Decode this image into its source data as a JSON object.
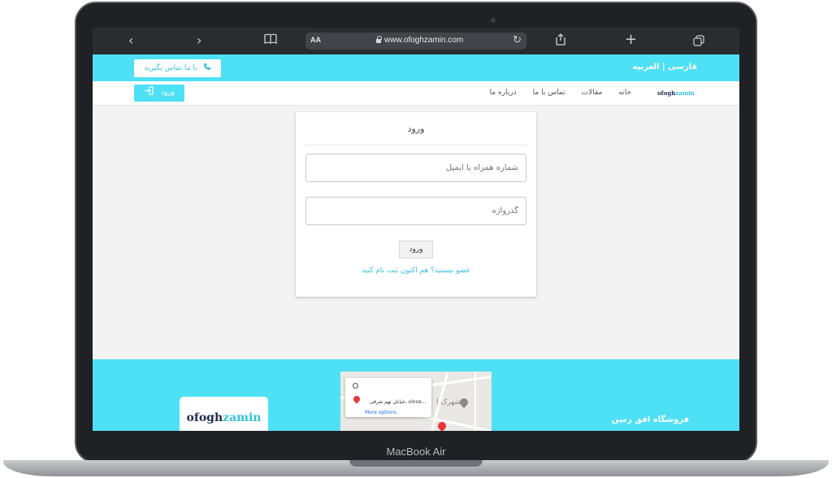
{
  "device": {
    "label": "MacBook Air"
  },
  "browser": {
    "url_aa": "AA",
    "url": "www.ofoghzamin.com",
    "icons": [
      "back-icon",
      "forward-icon",
      "bookmarks-icon",
      "lock-icon",
      "reload-icon",
      "share-icon",
      "new-tab-icon",
      "tabs-icon"
    ]
  },
  "topbar": {
    "contact_label": "با ما تماس بگیرید",
    "languages": "فارسی | العربیه"
  },
  "nav": {
    "login_label": "ورود",
    "links": [
      "خانه",
      "مقالات",
      "تماس با ما",
      "درباره ما"
    ],
    "logo_text_dark": "ofogh",
    "logo_text_accent": "zamin"
  },
  "login_card": {
    "title": "ورود",
    "username_placeholder": "شماره همراه یا ایمیل",
    "password_placeholder": "گذرواژه",
    "submit_label": "ورود",
    "register_link": "عضو نیستید؟ هم اکنون ثبت نام کنید"
  },
  "footer": {
    "logo_dark": "ofogh",
    "logo_accent": "zamin",
    "map_address": "خیابان نهم شرقی، vince...",
    "map_more": "More options",
    "map_label": "شهرک ا",
    "shop_name": "فروشگاه افق زمین"
  },
  "colors": {
    "accent": "#4ee0f5",
    "link": "#39c2db",
    "dark": "#1e2b4a"
  }
}
